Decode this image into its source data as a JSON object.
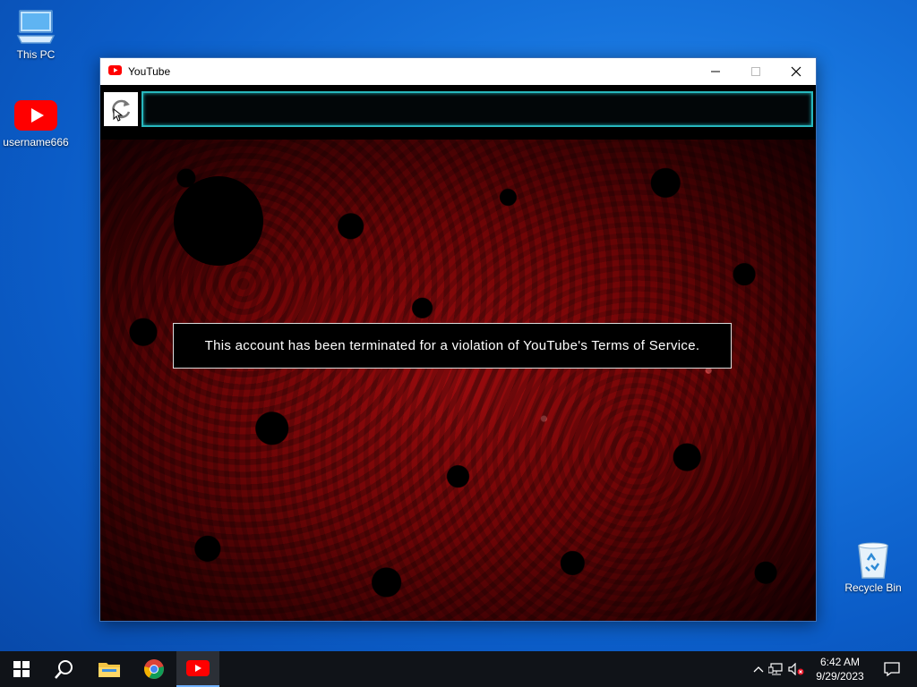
{
  "desktop": {
    "icons": [
      {
        "label": "This PC",
        "icon": "computer-icon"
      },
      {
        "label": "username666",
        "icon": "youtube-icon"
      },
      {
        "label": "Recycle Bin",
        "icon": "recycle-bin-icon"
      }
    ]
  },
  "window": {
    "title": "YouTube",
    "icon": "youtube-icon",
    "controls": [
      "minimize-icon",
      "maximize-icon",
      "close-icon"
    ]
  },
  "browser": {
    "reload_icon": "reload-icon",
    "address_value": ""
  },
  "page": {
    "banner_text": "This account has been terminated for a violation of YouTube's Terms of Service.",
    "background_color": "#8b0a0c"
  },
  "taskbar": {
    "items": [
      "windows-start-icon",
      "search-icon",
      "file-explorer-icon",
      "chrome-icon",
      "youtube-icon"
    ],
    "tray_icons": [
      "chevron-up-icon",
      "network-icon",
      "volume-muted-icon"
    ],
    "time": "6:42 AM",
    "date": "9/29/2023",
    "notification_icon": "notification-icon"
  },
  "colors": {
    "desktop": "#1270d8",
    "youtube_red": "#ff0000",
    "taskbar": "#101318",
    "url_border": "#27b7bd"
  }
}
